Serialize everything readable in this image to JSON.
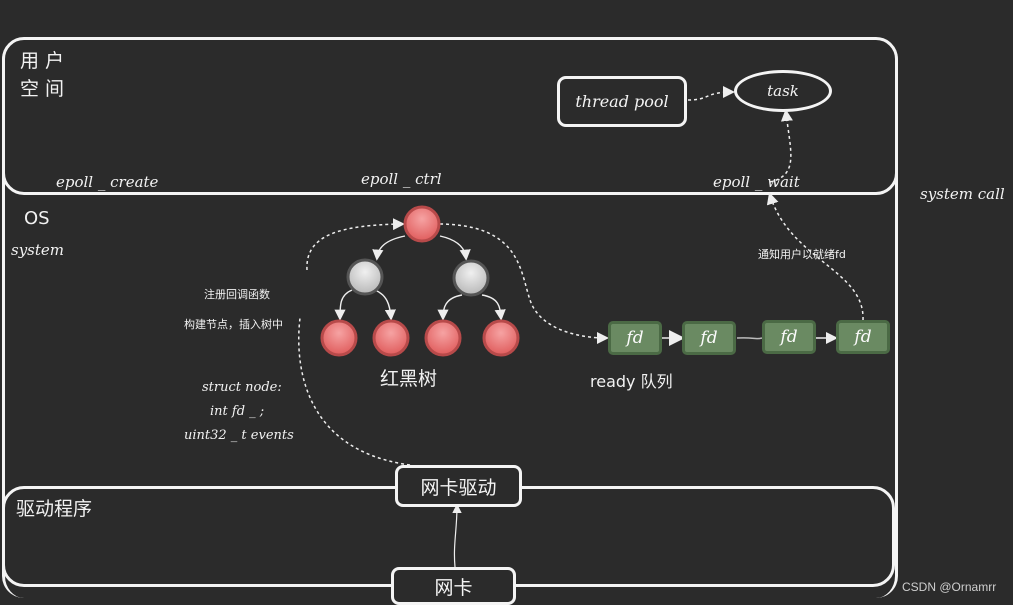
{
  "zones": {
    "user_space": "用户\n空间",
    "user_space_line1": "用 户",
    "user_space_line2": "空 间",
    "os": "OS",
    "system": "system",
    "driver": "驱动程序",
    "system_call": "system call"
  },
  "syscalls": {
    "create": "epoll _ create",
    "ctrl": "epoll _ ctrl",
    "wait": "epoll _ wait"
  },
  "user_boxes": {
    "thread_pool": "thread pool",
    "task": "task"
  },
  "annotations": {
    "register_callback": "注册回调函数",
    "build_node": "构建节点，插入树中",
    "struct_line1": "struct node:",
    "struct_line2": "int fd _ ;",
    "struct_line3": "uint32 _ t events",
    "notify_user": "通知用户以就绪fd"
  },
  "rbtree": {
    "label": "红黑树",
    "colors": {
      "red": "#e06a6a",
      "black": "#c8c8c8"
    }
  },
  "ready_queue": {
    "label": "ready 队列",
    "items": [
      "fd",
      "fd",
      "fd",
      "fd"
    ],
    "color": "#6a8a62"
  },
  "hardware": {
    "nic_driver": "网卡驱动",
    "nic": "网卡"
  },
  "watermark": "CSDN @Ornamrr"
}
